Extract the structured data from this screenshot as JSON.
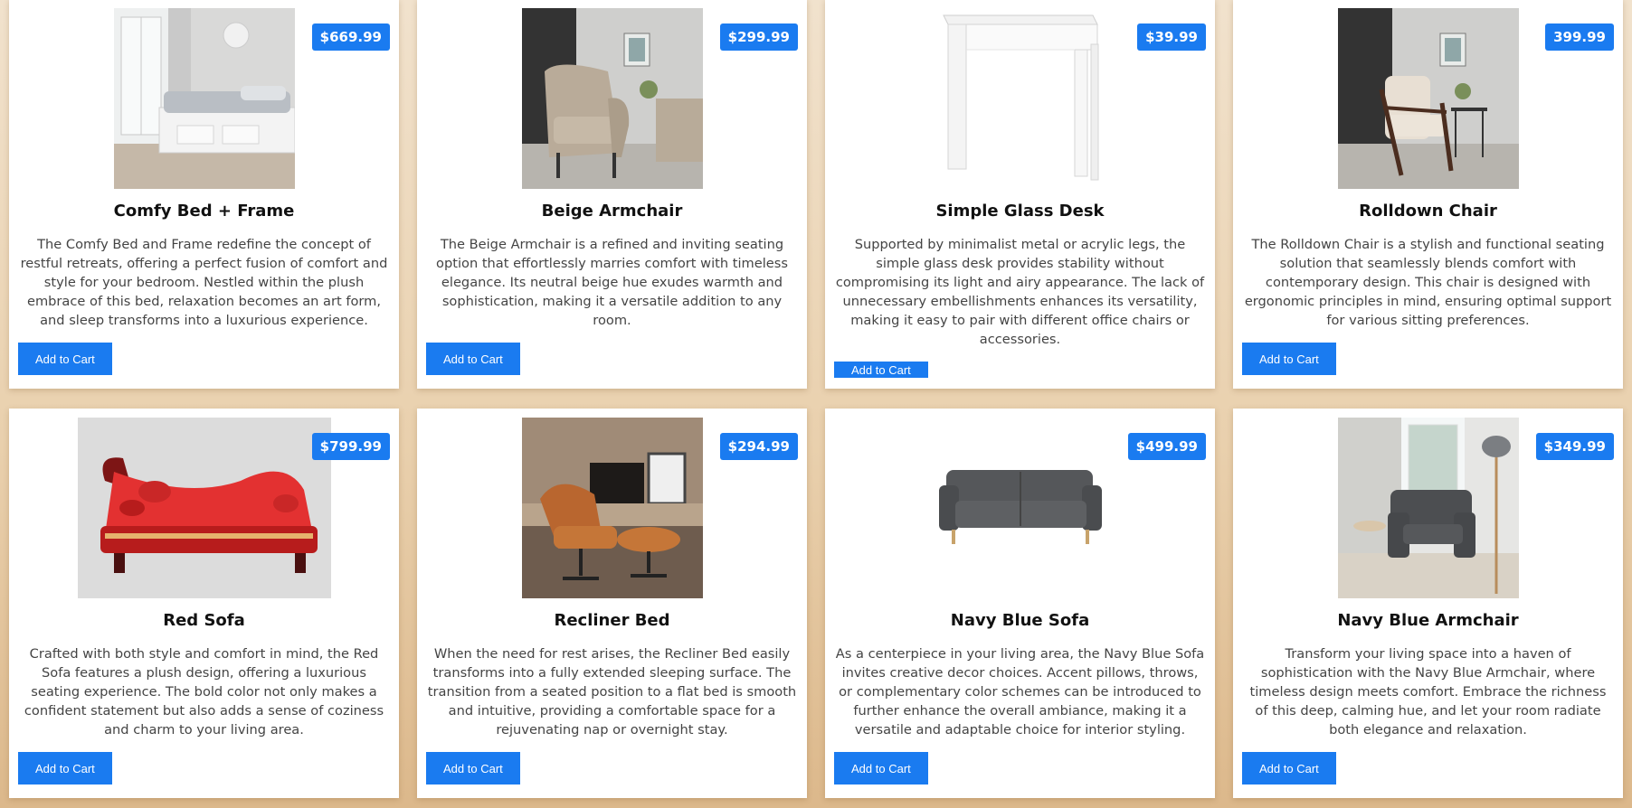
{
  "products": [
    {
      "name": "Comfy Bed + Frame",
      "price": "$669.99",
      "description": "The Comfy Bed and Frame redefine the concept of restful retreats, offering a perfect fusion of comfort and style for your bedroom. Nestled within the plush embrace of this bed, relaxation becomes an art form, and sleep transforms into a luxurious experience.",
      "button": "Add to Cart",
      "image_icon": "bed-icon"
    },
    {
      "name": "Beige Armchair",
      "price": "$299.99",
      "description": "The Beige Armchair is a refined and inviting seating option that effortlessly marries comfort with timeless elegance. Its neutral beige hue exudes warmth and sophistication, making it a versatile addition to any room.",
      "button": "Add to Cart",
      "image_icon": "armchair-icon"
    },
    {
      "name": "Simple Glass Desk",
      "price": "$39.99",
      "description": "Supported by minimalist metal or acrylic legs, the simple glass desk provides stability without compromising its light and airy appearance. The lack of unnecessary embellishments enhances its versatility, making it easy to pair with different office chairs or accessories.",
      "button": "Add to Cart",
      "image_icon": "desk-icon"
    },
    {
      "name": "Rolldown Chair",
      "price": "399.99",
      "description": "The Rolldown Chair is a stylish and functional seating solution that seamlessly blends comfort with contemporary design. This chair is designed with ergonomic principles in mind, ensuring optimal support for various sitting preferences.",
      "button": "Add to Cart",
      "image_icon": "chair-icon"
    },
    {
      "name": "Red Sofa",
      "price": "$799.99",
      "description": "Crafted with both style and comfort in mind, the Red Sofa features a plush design, offering a luxurious seating experience. The bold color not only makes a confident statement but also adds a sense of coziness and charm to your living area.",
      "button": "Add to Cart",
      "image_icon": "sofa-icon"
    },
    {
      "name": "Recliner Bed",
      "price": "$294.99",
      "description": "When the need for rest arises, the Recliner Bed easily transforms into a fully extended sleeping surface. The transition from a seated position to a flat bed is smooth and intuitive, providing a comfortable space for a rejuvenating nap or overnight stay.",
      "button": "Add to Cart",
      "image_icon": "recliner-icon"
    },
    {
      "name": "Navy Blue Sofa",
      "price": "$499.99",
      "description": "As a centerpiece in your living area, the Navy Blue Sofa invites creative decor choices. Accent pillows, throws, or complementary color schemes can be introduced to further enhance the overall ambiance, making it a versatile and adaptable choice for interior styling.",
      "button": "Add to Cart",
      "image_icon": "sofa-icon"
    },
    {
      "name": "Navy Blue Armchair",
      "price": "$349.99",
      "description": "Transform your living space into a haven of sophistication with the Navy Blue Armchair, where timeless design meets comfort. Embrace the richness of this deep, calming hue, and let your room radiate both elegance and relaxation.",
      "button": "Add to Cart",
      "image_icon": "armchair-icon"
    }
  ],
  "colors": {
    "accent": "#1a7bf0",
    "background": "#e9d0ad",
    "card": "#ffffff"
  }
}
